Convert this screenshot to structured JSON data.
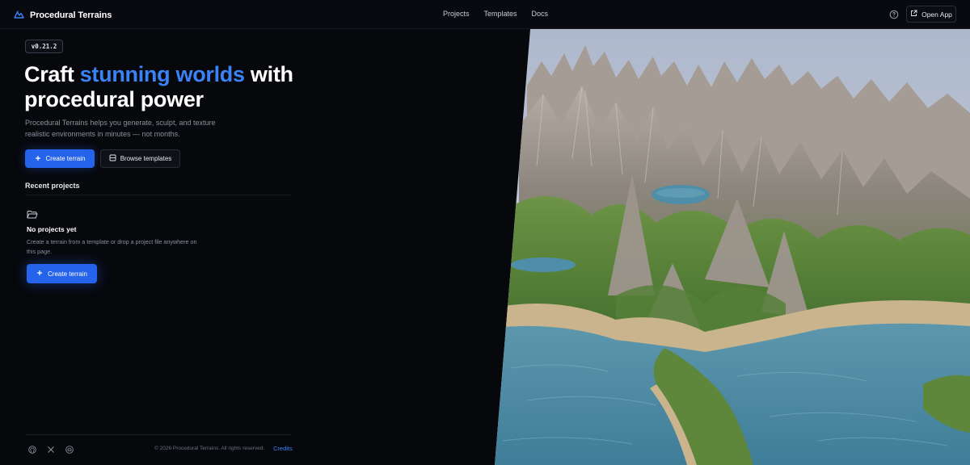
{
  "brand": {
    "name": "Procedural Terrains",
    "logo_icon": "mountain-icon",
    "accent": "#3b82f6"
  },
  "nav": {
    "items": [
      "Projects",
      "Templates",
      "Docs"
    ]
  },
  "header": {
    "help_icon": "help-circle-icon",
    "open_app_label": "Open App",
    "open_app_icon": "external-link-icon"
  },
  "hero": {
    "version": "v0.21.2",
    "headline_part1": "Craft ",
    "headline_accent": "stunning worlds",
    "headline_part2": " with procedural power",
    "subtitle": "Procedural Terrains helps you generate, sculpt, and texture realistic environments in minutes — not months.",
    "primary_button": "Create terrain",
    "secondary_button": "Browse templates"
  },
  "recent": {
    "title": "Recent projects",
    "empty_icon": "folder-open-icon",
    "empty_title": "No projects yet",
    "empty_description": "Create a terrain from a template or drop a project file anywhere on this page.",
    "empty_button": "Create terrain"
  },
  "footer": {
    "social_icons": [
      "github-icon",
      "x-icon",
      "discord-icon"
    ],
    "copyright": "© 2026 Procedural Terrains. All rights reserved.",
    "credits": "Credits"
  },
  "colors": {
    "background": "#07080c",
    "primary_button": "#2563eb",
    "water": "#4a8aa5",
    "grass": "#5d8a3e",
    "rock": "#a8a098",
    "sky": "#c9d1e0"
  }
}
